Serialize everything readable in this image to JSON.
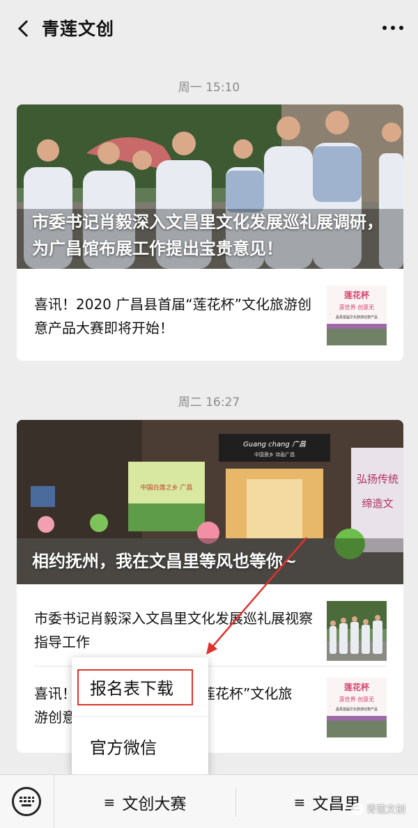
{
  "header": {
    "title": "青莲文创",
    "back_icon": "chevron-left-icon",
    "more_icon": "more-dots-icon"
  },
  "groups": [
    {
      "timestamp": "周一 15:10",
      "hero_title": "市委书记肖毅深入文昌里文化发展巡礼展调研，为广昌馆布展工作提出宝贵意见！",
      "items": [
        {
          "title": "喜讯！2020 广昌县首届“莲花杯”文化旅游创意产品大赛即将开始！"
        }
      ]
    },
    {
      "timestamp": "周二 16:27",
      "hero_title": "相约抚州，我在文昌里等风也等你~",
      "items": [
        {
          "title": "市委书记肖毅深入文昌里文化发展巡礼展视察指导工作"
        },
        {
          "title_left": "喜讯！",
          "title_right": "莲花杯”文化旅",
          "line2_left": "游创意",
          "line2_right": "！"
        }
      ]
    }
  ],
  "thumbs": {
    "lotus_line1": "莲花杯",
    "lotus_line2": "莲世界 创意无",
    "lotus_caption": "昌县首届文化旅游创意产品"
  },
  "storefront": {
    "sign_title": "Guang chang 广昌",
    "sign_sub": "中国莲乡 诗画广昌",
    "poster_text": "中国白莲之乡 广昌",
    "banner_line1": "弘扬传统",
    "banner_line2": "缔造文"
  },
  "popup_menu": {
    "items": [
      "报名表下载",
      "官方微信"
    ],
    "highlighted": "报名表下载",
    "highlight_color": "#e0312b"
  },
  "bottom_bar": {
    "keyboard_icon": "keyboard-icon",
    "tabs": [
      {
        "label": "文创大赛",
        "icon": "hamburger-icon"
      },
      {
        "label": "文昌里",
        "icon": "hamburger-icon"
      }
    ]
  },
  "watermark": "青莲文创"
}
